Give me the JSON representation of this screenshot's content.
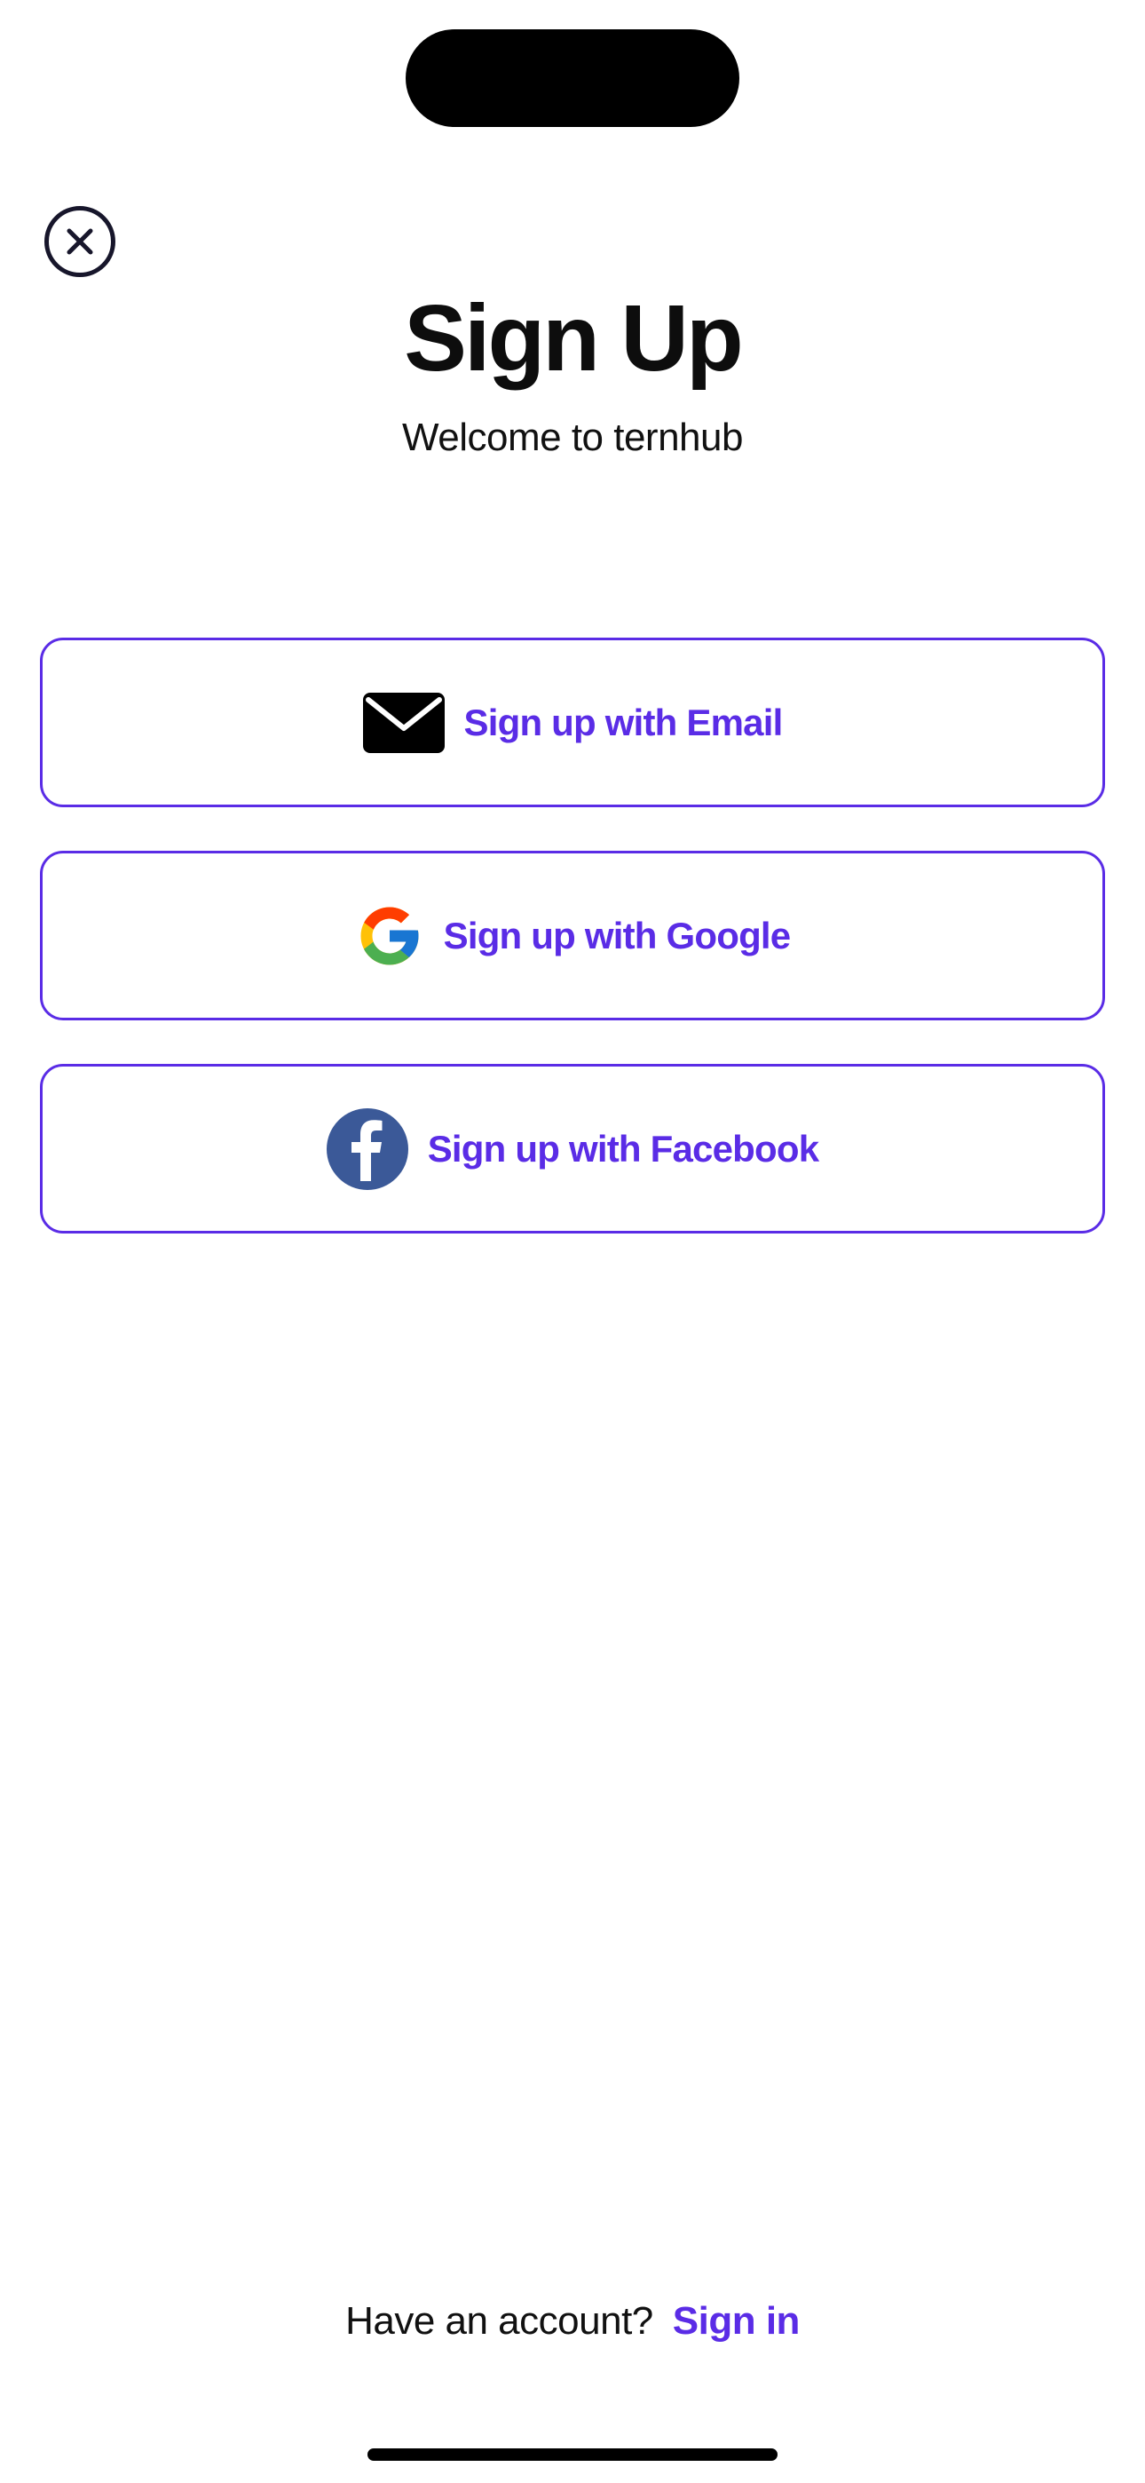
{
  "header": {
    "title": "Sign Up",
    "subtitle": "Welcome to ternhub",
    "close_icon": "close-icon"
  },
  "auth_options": {
    "email": {
      "label": "Sign up with Email",
      "icon": "envelope-icon"
    },
    "google": {
      "label": "Sign up with Google",
      "icon": "google-logo-icon"
    },
    "facebook": {
      "label": "Sign up with Facebook",
      "icon": "facebook-logo-icon"
    }
  },
  "footer": {
    "prompt": "Have an account?",
    "signin_label": "Sign in"
  },
  "colors": {
    "accent": "#5a2ce6",
    "text": "#111111",
    "background": "#ffffff",
    "facebook": "#3b5998"
  }
}
